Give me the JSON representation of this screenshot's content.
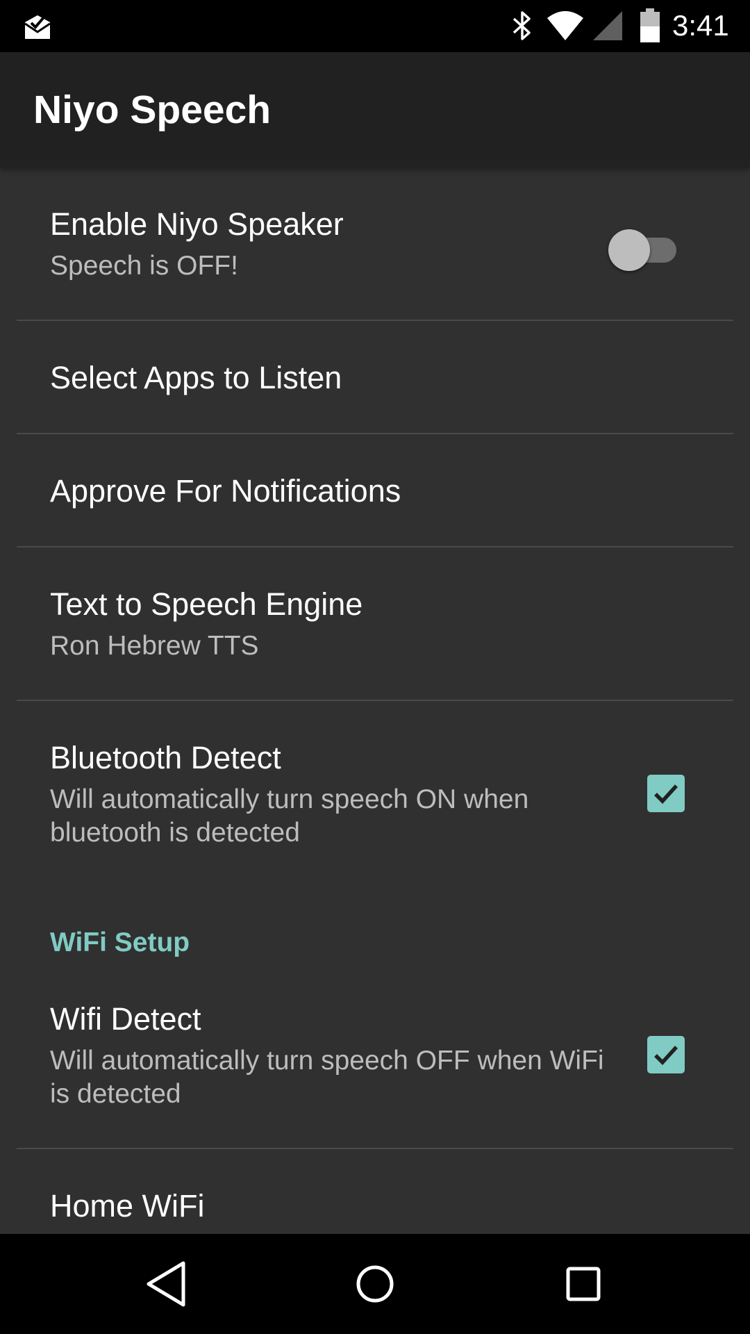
{
  "status_bar": {
    "time": "3:41",
    "icons": [
      "mail-done-icon",
      "bluetooth-icon",
      "wifi-icon",
      "signal-icon",
      "battery-icon"
    ]
  },
  "app_bar": {
    "title": "Niyo Speech"
  },
  "preferences": {
    "enable_speaker": {
      "title": "Enable Niyo Speaker",
      "summary": "Speech is OFF!",
      "switch_on": false
    },
    "select_apps": {
      "title": "Select Apps to Listen"
    },
    "approve_notifications": {
      "title": "Approve For Notifications"
    },
    "tts_engine": {
      "title": "Text to Speech Engine",
      "summary": "Ron Hebrew TTS"
    },
    "bluetooth_detect": {
      "title": "Bluetooth Detect",
      "summary": "Will automatically turn speech ON when bluetooth is detected",
      "checked": true
    },
    "wifi_category": {
      "title": "WiFi Setup"
    },
    "wifi_detect": {
      "title": "Wifi Detect",
      "summary": "Will automatically turn speech OFF when WiFi is detected",
      "checked": true
    },
    "home_wifi": {
      "title": "Home WiFi"
    }
  },
  "nav_bar": {
    "buttons": [
      "back-icon",
      "home-icon",
      "recents-icon"
    ]
  },
  "colors": {
    "accent": "#80cbc4",
    "background": "#303030",
    "app_bar": "#212121"
  }
}
